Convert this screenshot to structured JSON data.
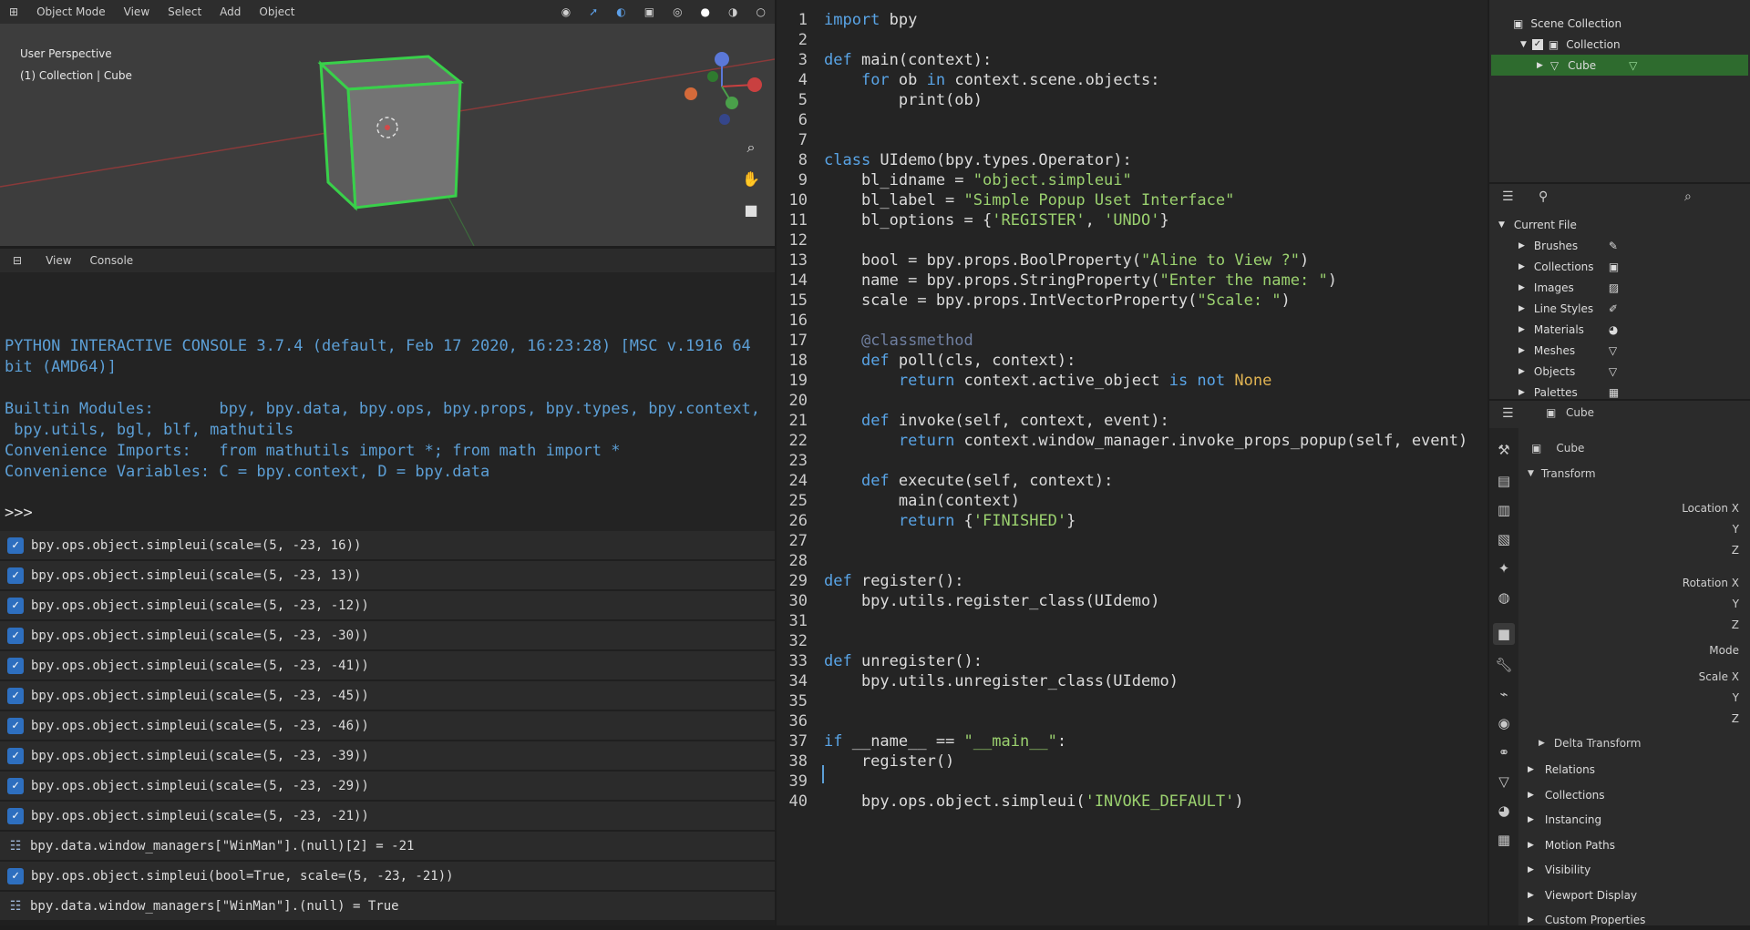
{
  "viewport": {
    "mode": "Object Mode",
    "menu": [
      "View",
      "Select",
      "Add",
      "Object"
    ],
    "transform_orientation": "Global",
    "overlay_line1": "User Perspective",
    "overlay_line2": "(1) Collection | Cube",
    "gizmo_labels": {
      "z": "Z",
      "y": "Y",
      "x": "X"
    }
  },
  "console": {
    "header_menu": [
      "View",
      "Console"
    ],
    "lines": [
      "PYTHON INTERACTIVE CONSOLE 3.7.4 (default, Feb 17 2020, 16:23:28) [MSC v.1916 64",
      "bit (AMD64)]",
      "",
      "Builtin Modules:       bpy, bpy.data, bpy.ops, bpy.props, bpy.types, bpy.context,",
      " bpy.utils, bgl, blf, mathutils",
      "Convenience Imports:   from mathutils import *; from math import *",
      "Convenience Variables: C = bpy.context, D = bpy.data"
    ],
    "prompt": ">>> "
  },
  "info_log": [
    {
      "icon": "check",
      "text": "bpy.ops.object.simpleui(scale=(5, -23, 16))"
    },
    {
      "icon": "check",
      "text": "bpy.ops.object.simpleui(scale=(5, -23, 13))"
    },
    {
      "icon": "check",
      "text": "bpy.ops.object.simpleui(scale=(5, -23, -12))"
    },
    {
      "icon": "check",
      "text": "bpy.ops.object.simpleui(scale=(5, -23, -30))"
    },
    {
      "icon": "check",
      "text": "bpy.ops.object.simpleui(scale=(5, -23, -41))"
    },
    {
      "icon": "check",
      "text": "bpy.ops.object.simpleui(scale=(5, -23, -45))"
    },
    {
      "icon": "check",
      "text": "bpy.ops.object.simpleui(scale=(5, -23, -46))"
    },
    {
      "icon": "check",
      "text": "bpy.ops.object.simpleui(scale=(5, -23, -39))"
    },
    {
      "icon": "check",
      "text": "bpy.ops.object.simpleui(scale=(5, -23, -29))"
    },
    {
      "icon": "check",
      "text": "bpy.ops.object.simpleui(scale=(5, -23, -21))"
    },
    {
      "icon": "property",
      "text": "bpy.data.window_managers[\"WinMan\"].(null)[2] = -21"
    },
    {
      "icon": "check",
      "text": "bpy.ops.object.simpleui(bool=True, scale=(5, -23, -21))"
    },
    {
      "icon": "property",
      "text": "bpy.data.window_managers[\"WinMan\"].(null) = True"
    }
  ],
  "editor": {
    "line_numbers": [
      "1",
      "2",
      "3",
      "4",
      "5",
      "6",
      "7",
      "8",
      "9",
      "10",
      "11",
      "12",
      "13",
      "14",
      "15",
      "16",
      "17",
      "18",
      "19",
      "20",
      "21",
      "22",
      "23",
      "24",
      "25",
      "26",
      "27",
      "28",
      "29",
      "30",
      "31",
      "32",
      "33",
      "34",
      "35",
      "36",
      "37",
      "38",
      "39",
      "40"
    ],
    "lines": [
      [
        {
          "t": "import",
          "c": "kw"
        },
        {
          "t": " bpy"
        }
      ],
      [],
      [
        {
          "t": "def",
          "c": "kw"
        },
        {
          "t": " main(context):"
        }
      ],
      [
        {
          "t": "    "
        },
        {
          "t": "for",
          "c": "kw"
        },
        {
          "t": " ob "
        },
        {
          "t": "in",
          "c": "kw"
        },
        {
          "t": " context.scene.objects:"
        }
      ],
      [
        {
          "t": "        print(ob)"
        }
      ],
      [],
      [],
      [
        {
          "t": "class",
          "c": "kw"
        },
        {
          "t": " UIdemo(bpy.types.Operator):"
        }
      ],
      [
        {
          "t": "    bl_idname = "
        },
        {
          "t": "\"object.simpleui\"",
          "c": "str"
        }
      ],
      [
        {
          "t": "    bl_label = "
        },
        {
          "t": "\"Simple Popup Uset Interface\"",
          "c": "str"
        }
      ],
      [
        {
          "t": "    bl_options = {"
        },
        {
          "t": "'REGISTER'",
          "c": "str"
        },
        {
          "t": ", "
        },
        {
          "t": "'UNDO'",
          "c": "str"
        },
        {
          "t": "}"
        }
      ],
      [],
      [
        {
          "t": "    bool = bpy.props.BoolProperty("
        },
        {
          "t": "\"Aline to View ?\"",
          "c": "str"
        },
        {
          "t": ")"
        }
      ],
      [
        {
          "t": "    name = bpy.props.StringProperty("
        },
        {
          "t": "\"Enter the name: \"",
          "c": "str"
        },
        {
          "t": ")"
        }
      ],
      [
        {
          "t": "    scale = bpy.props.IntVectorProperty("
        },
        {
          "t": "\"Scale: \"",
          "c": "str"
        },
        {
          "t": ")"
        }
      ],
      [],
      [
        {
          "t": "    "
        },
        {
          "t": "@classmethod",
          "c": "dec"
        }
      ],
      [
        {
          "t": "    "
        },
        {
          "t": "def",
          "c": "kw"
        },
        {
          "t": " poll(cls, context):"
        }
      ],
      [
        {
          "t": "        "
        },
        {
          "t": "return",
          "c": "kw"
        },
        {
          "t": " context.active_object "
        },
        {
          "t": "is not",
          "c": "kw"
        },
        {
          "t": " "
        },
        {
          "t": "None",
          "c": "spc"
        }
      ],
      [],
      [
        {
          "t": "    "
        },
        {
          "t": "def",
          "c": "kw"
        },
        {
          "t": " invoke(self, context, event):"
        }
      ],
      [
        {
          "t": "        "
        },
        {
          "t": "return",
          "c": "kw"
        },
        {
          "t": " context.window_manager.invoke_props_popup(self, event)"
        }
      ],
      [],
      [
        {
          "t": "    "
        },
        {
          "t": "def",
          "c": "kw"
        },
        {
          "t": " execute(self, context):"
        }
      ],
      [
        {
          "t": "        main(context)"
        }
      ],
      [
        {
          "t": "        "
        },
        {
          "t": "return",
          "c": "kw"
        },
        {
          "t": " {"
        },
        {
          "t": "'FINISHED'",
          "c": "str"
        },
        {
          "t": "}"
        }
      ],
      [],
      [],
      [
        {
          "t": "def",
          "c": "kw"
        },
        {
          "t": " register():"
        }
      ],
      [
        {
          "t": "    bpy.utils.register_class(UIdemo)"
        }
      ],
      [],
      [],
      [
        {
          "t": "def",
          "c": "kw"
        },
        {
          "t": " unregister():"
        }
      ],
      [
        {
          "t": "    bpy.utils.unregister_class(UIdemo)"
        }
      ],
      [],
      [],
      [
        {
          "t": "if",
          "c": "kw"
        },
        {
          "t": " __name__ == "
        },
        {
          "t": "\"__main__\"",
          "c": "str"
        },
        {
          "t": ":"
        }
      ],
      [
        {
          "t": "    register()"
        }
      ],
      [],
      [
        {
          "t": "    bpy.ops.object.simpleui("
        },
        {
          "t": "'INVOKE_DEFAULT'",
          "c": "str"
        },
        {
          "t": ")"
        }
      ]
    ]
  },
  "outliner": {
    "scene_collection": "Scene Collection",
    "collection": "Collection",
    "cube": "Cube"
  },
  "file_browser": {
    "current_file": "Current File",
    "items": [
      "Brushes",
      "Collections",
      "Images",
      "Line Styles",
      "Materials",
      "Meshes",
      "Objects",
      "Palettes"
    ]
  },
  "properties": {
    "header_object": "Cube",
    "object_name": "Cube",
    "transform": "Transform",
    "labels": [
      {
        "text": "Location X"
      },
      {
        "text": "Y"
      },
      {
        "text": "Z"
      },
      {
        "text": "Rotation X"
      },
      {
        "text": "Y"
      },
      {
        "text": "Z"
      },
      {
        "text": "Mode"
      },
      {
        "text": "Scale X"
      },
      {
        "text": "Y"
      },
      {
        "text": "Z"
      }
    ],
    "delta_transform": "Delta Transform",
    "panels": [
      "Relations",
      "Collections",
      "Instancing",
      "Motion Paths",
      "Visibility",
      "Viewport Display",
      "Custom Properties"
    ]
  },
  "colors": {
    "accent": "#2e6fbf",
    "selected": "#2e6b2e",
    "keyword": "#59a4e6",
    "string": "#9bd16f"
  }
}
